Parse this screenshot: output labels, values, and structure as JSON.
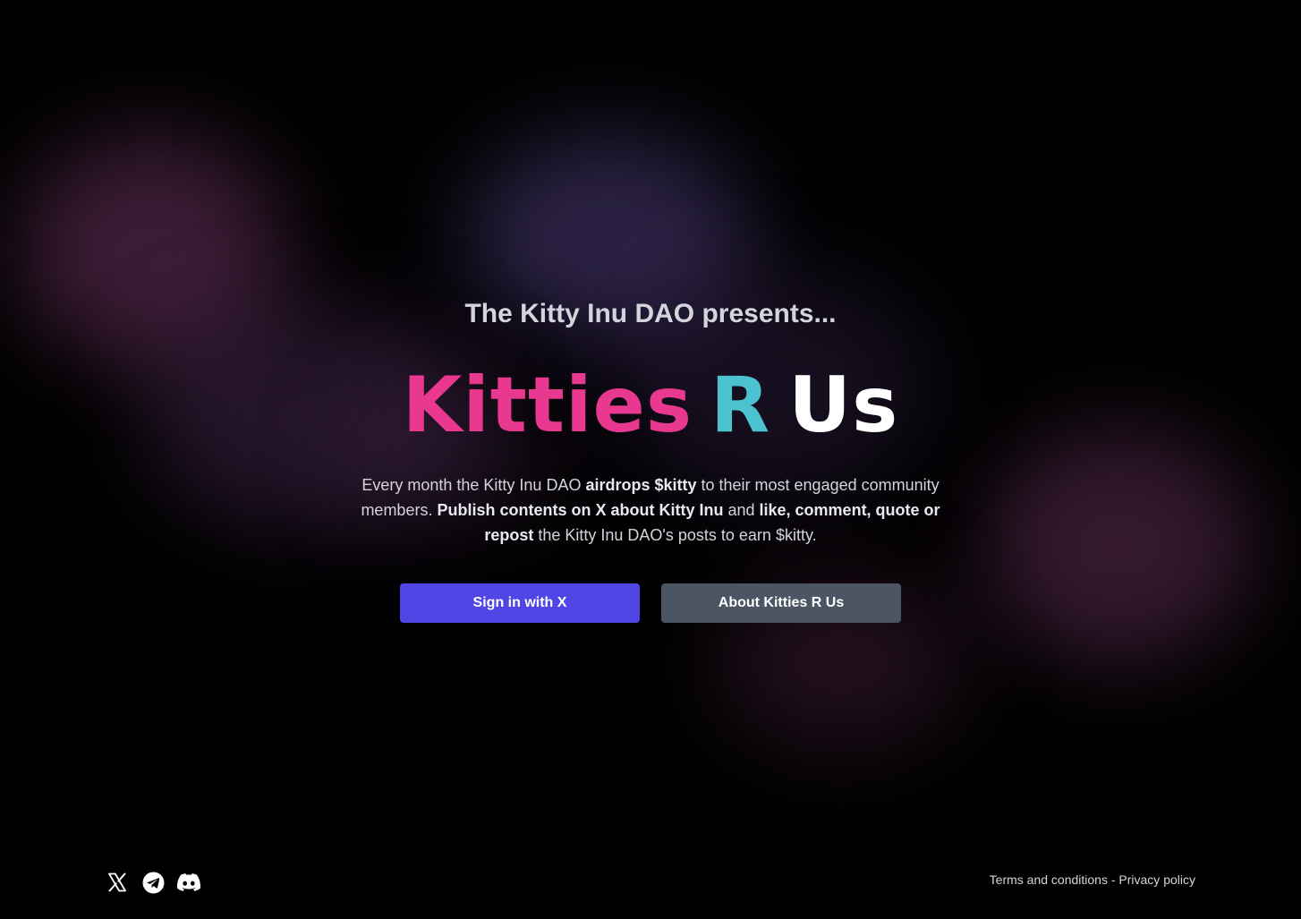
{
  "hero": {
    "subtitle": "The Kitty Inu DAO presents...",
    "brand_word1": "Kitties",
    "brand_word2": "R",
    "brand_word3": "Us",
    "brand_colors": {
      "word1": "#e8388f",
      "word2": "#4ac2d0",
      "word3": "#ffffff"
    }
  },
  "description": {
    "p1": "Every month the Kitty Inu DAO ",
    "b1": "airdrops $kitty",
    "p2": " to their most engaged community members. ",
    "b2": "Publish contents on X about Kitty Inu",
    "p3": " and ",
    "b3": "like, comment, quote or repost",
    "p4": " the Kitty Inu DAO's posts to earn $kitty."
  },
  "actions": {
    "sign_in_label": "Sign in with X",
    "about_label": "About Kitties R Us",
    "primary_color": "#4f46e5",
    "secondary_color": "#4b5563"
  },
  "footer": {
    "social_icons": [
      "x-icon",
      "telegram-icon",
      "discord-icon"
    ],
    "terms_label": "Terms and conditions",
    "separator": " - ",
    "privacy_label": "Privacy policy"
  }
}
